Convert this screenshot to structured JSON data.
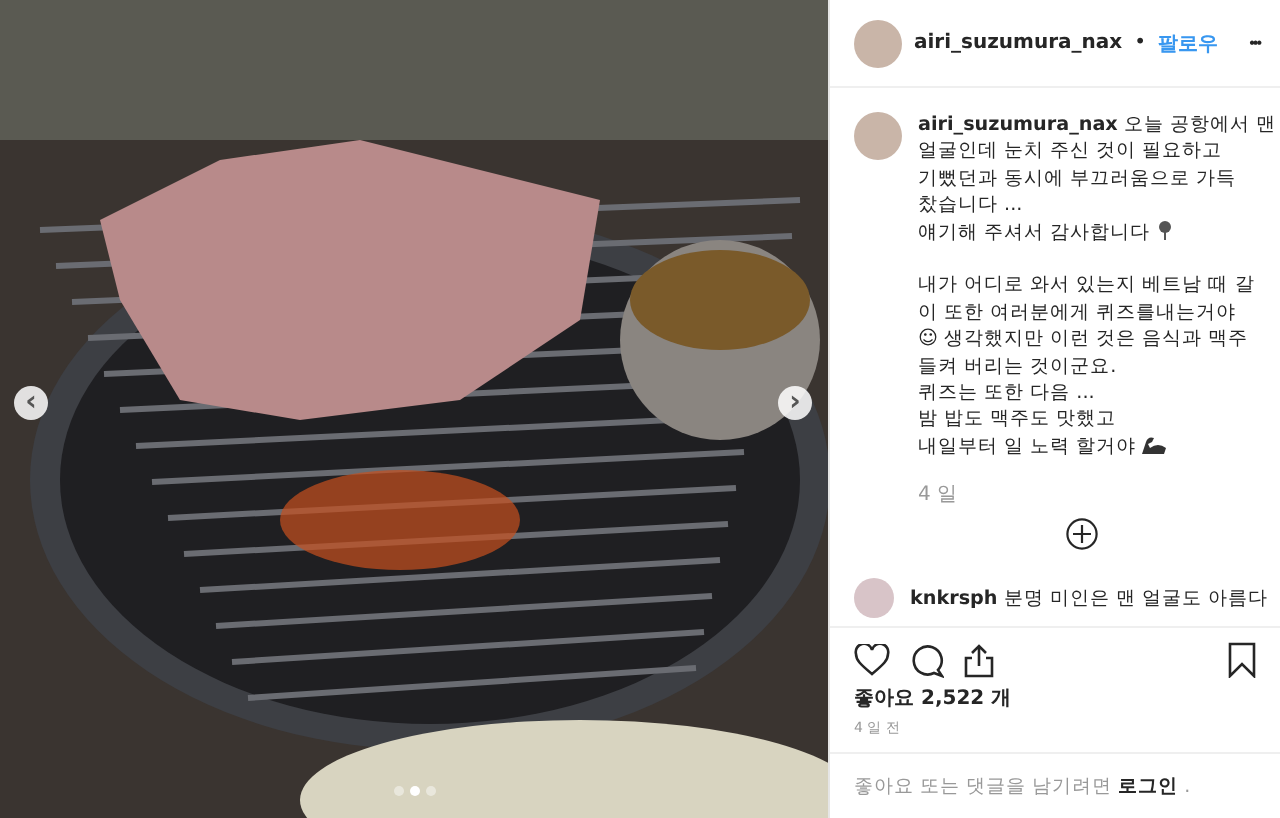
{
  "photo": {
    "dots": [
      {
        "selected": false
      },
      {
        "selected": true
      },
      {
        "selected": false
      }
    ],
    "prev_button": "‹",
    "next_button": "›"
  },
  "header": {
    "username": "airi_suzumura_nax",
    "separator": "•",
    "follow": "팔로우",
    "more": "•••"
  },
  "caption": {
    "username": "airi_suzumura_nax",
    "paragraphs": [
      {
        "lines": [
          "오늘 공항에서 맨",
          "얼굴인데 눈치 주신 것이 필요하고",
          "기뻤던과 동시에 부끄러움으로 가득",
          "찼습니다 ...",
          "얘기해 주셔서 감사합니다"
        ],
        "ends_with_icon": true
      },
      {
        "lines": [
          "내가 어디로 와서 있는지 베트남 때 갈",
          "이 또한 여러분에게 퀴즈를내는거야",
          "☺ 생각했지만 이런 것은 음식과 맥주",
          "들켜 버리는 것이군요.",
          "퀴즈는 또한 다음 ...",
          "밤 밥도 맥주도 맛했고",
          "내일부터 일 노력 할거야"
        ],
        "ends_with_icon": true
      }
    ],
    "time": "4 일"
  },
  "comments": [
    {
      "username": "knkrsph",
      "text": "분명 미인은 맨 얼굴도 아름다"
    }
  ],
  "likes": "좋아요 2,522 개",
  "posted": "4 일 전",
  "login": {
    "before": "좋아요 또는 댓글을 남기려면",
    "link": "로그인",
    "after": "."
  }
}
